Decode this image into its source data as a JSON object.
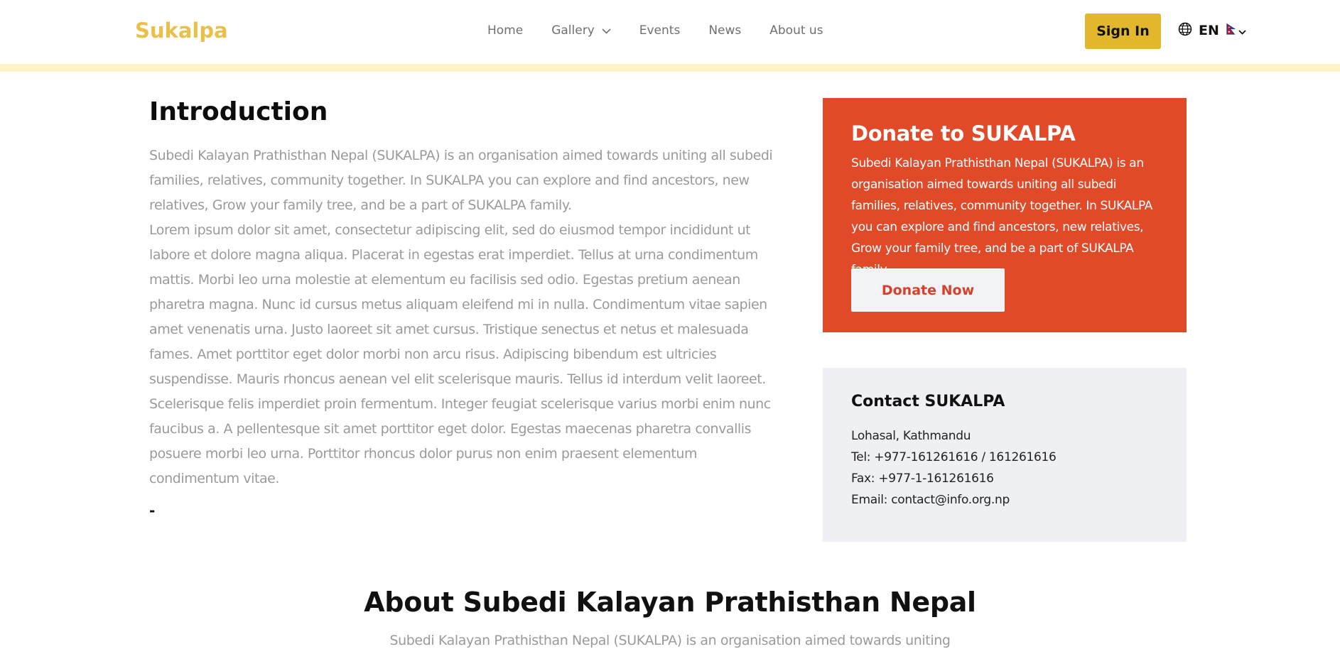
{
  "header": {
    "logo": "Sukalpa",
    "nav": [
      {
        "label": "Home"
      },
      {
        "label": "Gallery",
        "has_dropdown": true
      },
      {
        "label": "Events"
      },
      {
        "label": "News"
      },
      {
        "label": "About us"
      }
    ],
    "sign_in_label": "Sign In",
    "language": {
      "code": "EN",
      "icon": "globe-icon",
      "flag_icon": "nepal-flag-icon"
    }
  },
  "intro": {
    "title": "Introduction",
    "paragraph1": "Subedi Kalayan Prathisthan Nepal (SUKALPA) is an organisation aimed towards uniting all subedi families, relatives, community together. In SUKALPA you can explore and find ancestors, new relatives, Grow your family tree, and be a part of SUKALPA family.",
    "paragraph2": "Lorem ipsum dolor sit amet, consectetur adipiscing elit, sed do eiusmod tempor incididunt ut labore et dolore magna aliqua. Placerat in egestas erat imperdiet. Tellus at urna condimentum mattis. Morbi leo urna molestie at elementum eu facilisis sed odio. Egestas pretium aenean pharetra magna. Nunc id cursus metus aliquam eleifend mi in nulla. Condimentum vitae sapien amet venenatis urna. Justo laoreet sit amet cursus. Tristique senectus et netus et malesuada fames. Amet porttitor eget dolor morbi non arcu risus. Adipiscing bibendum est ultricies suspendisse. Mauris rhoncus aenean vel elit scelerisque mauris. Tellus id interdum velit laoreet. Scelerisque felis imperdiet proin fermentum. Integer feugiat scelerisque varius morbi enim nunc faucibus a. A pellentesque sit amet porttitor eget dolor. Egestas maecenas pharetra convallis posuere morbi leo urna. Porttitor rhoncus dolor purus non enim praesent elementum condimentum vitae.",
    "trailing": "-"
  },
  "donate": {
    "title": "Donate to SUKALPA",
    "text": "Subedi Kalayan Prathisthan Nepal (SUKALPA) is an organisation aimed towards uniting all subedi families, relatives, community together. In SUKALPA you can explore and find ancestors, new relatives, Grow your family tree, and be a part of SUKALPA family.",
    "button_label": "Donate Now"
  },
  "contact": {
    "title": "Contact SUKALPA",
    "address": "Lohasal, Kathmandu",
    "tel": "Tel: +977-161261616 / 161261616",
    "fax": "Fax: +977-1-161261616",
    "email": "Email: contact@info.org.np"
  },
  "about": {
    "title_bold": "About",
    "title_rest": " Subedi Kalayan Prathisthan Nepal",
    "text": "Subedi Kalayan Prathisthan Nepal (SUKALPA) is an organisation aimed towards uniting"
  },
  "colors": {
    "logo": "#e9c04a",
    "accent_button": "#e3b72c",
    "header_strip": "#fdf3c6",
    "donate_bg": "#e04a28",
    "donate_button_text": "#d8402a",
    "contact_bg": "#eef0f3",
    "muted_text": "#9a9a9a"
  }
}
